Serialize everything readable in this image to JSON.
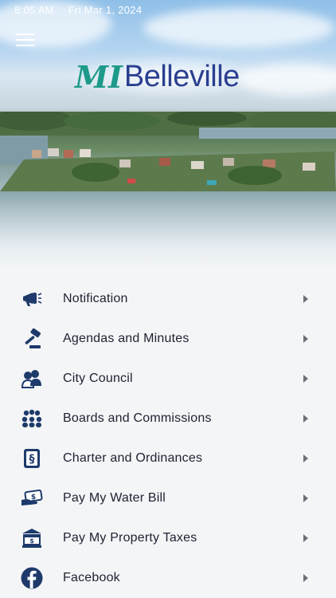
{
  "status_bar": {
    "time": "8:05 AM",
    "date": "Fri Mar 1, 2024"
  },
  "header": {
    "logo_mark": "MI",
    "logo_text": "Belleville"
  },
  "colors": {
    "icon": "#1e3a6b",
    "brand_teal": "#1d9a8a",
    "brand_navy": "#2a3f8f"
  },
  "menu": [
    {
      "label": "Notification",
      "icon": "megaphone-icon"
    },
    {
      "label": "Agendas and Minutes",
      "icon": "gavel-icon"
    },
    {
      "label": "City Council",
      "icon": "people-icon"
    },
    {
      "label": "Boards and Commissions",
      "icon": "group-icon"
    },
    {
      "label": "Charter and Ordinances",
      "icon": "law-book-icon"
    },
    {
      "label": "Pay My Water Bill",
      "icon": "money-hand-icon"
    },
    {
      "label": "Pay My Property Taxes",
      "icon": "bank-icon"
    },
    {
      "label": "Facebook",
      "icon": "facebook-icon"
    }
  ]
}
